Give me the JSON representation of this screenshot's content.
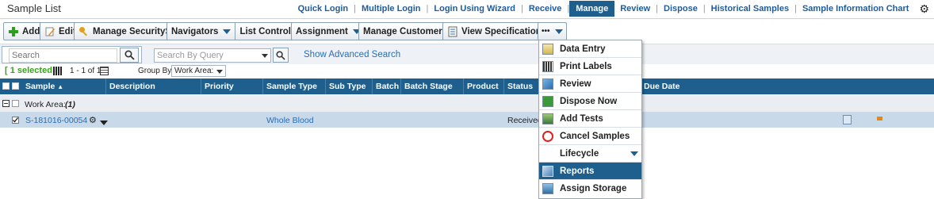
{
  "app": {
    "title": "Sample List"
  },
  "topnav": {
    "links": [
      "Quick Login",
      "Multiple Login",
      "Login Using Wizard",
      "Receive",
      "Manage",
      "Review",
      "Dispose",
      "Historical Samples",
      "Sample Information Chart"
    ],
    "active": "Manage"
  },
  "toolbar": {
    "add": "Add",
    "edit": "Edit",
    "manage_securityset": "Manage SecuritySet",
    "navigators": "Navigators",
    "list_control": "List Control",
    "assignment": "Assignment",
    "manage_customers": "Manage Customers",
    "view_specifications": "View Specifications",
    "more": "•••"
  },
  "search": {
    "placeholder": "Search",
    "query_placeholder": "Search By Query",
    "advanced": "Show Advanced Search"
  },
  "info": {
    "selected": "[ 1 selected ]",
    "pager": "1 - 1 of 1",
    "group_by_label": "Group By",
    "group_by_value": "Work Area:"
  },
  "grid": {
    "columns": [
      "Sample",
      "Description",
      "Priority",
      "Sample Type",
      "Sub Type",
      "Batch",
      "Batch Stage",
      "Product",
      "Status",
      "Due Date"
    ],
    "sort_indicator": "▲",
    "group_label": "Work Area:",
    "group_value": "(1)",
    "rows": [
      {
        "sample": "S-181016-00054",
        "sample_type": "Whole Blood",
        "status": "Received"
      }
    ]
  },
  "menu": {
    "items": [
      {
        "label": "Data Entry",
        "icon": "data-entry-icon"
      },
      {
        "label": "Print Labels",
        "icon": "barcode-icon"
      },
      {
        "label": "Review",
        "icon": "review-icon"
      },
      {
        "label": "Dispose Now",
        "icon": "dispose-icon"
      },
      {
        "label": "Add Tests",
        "icon": "add-tests-icon"
      },
      {
        "label": "Cancel Samples",
        "icon": "cancel-icon"
      },
      {
        "label": "Lifecycle",
        "icon": ""
      },
      {
        "label": "Reports",
        "icon": "reports-icon"
      },
      {
        "label": "Assign Storage",
        "icon": "storage-icon"
      }
    ],
    "active": "Reports"
  }
}
